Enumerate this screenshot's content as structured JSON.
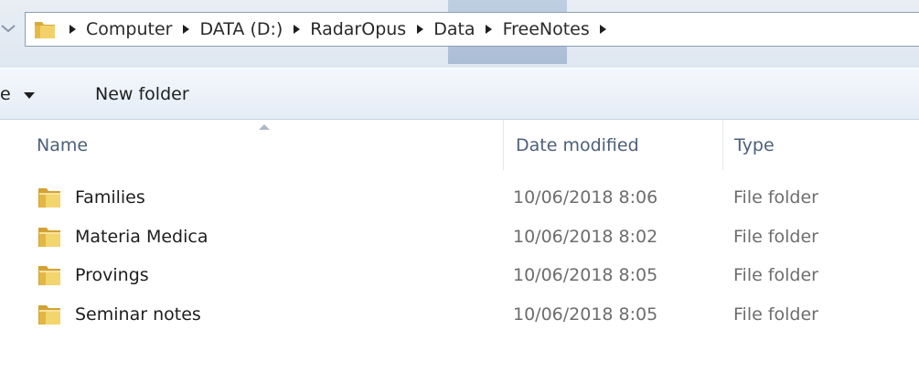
{
  "breadcrumb": [
    {
      "label": "Computer"
    },
    {
      "label": "DATA (D:)"
    },
    {
      "label": "RadarOpus"
    },
    {
      "label": "Data"
    },
    {
      "label": "FreeNotes"
    }
  ],
  "toolbar": {
    "organize_label": "e",
    "new_folder_label": "New folder"
  },
  "columns": {
    "name": "Name",
    "date_modified": "Date modified",
    "type": "Type"
  },
  "files": [
    {
      "name": "Families",
      "date": "10/06/2018 8:06",
      "type": "File folder",
      "icon": "folder-icon"
    },
    {
      "name": "Materia Medica",
      "date": "10/06/2018 8:02",
      "type": "File folder",
      "icon": "folder-icon"
    },
    {
      "name": "Provings",
      "date": "10/06/2018 8:05",
      "type": "File folder",
      "icon": "folder-icon"
    },
    {
      "name": "Seminar notes",
      "date": "10/06/2018 8:05",
      "type": "File folder",
      "icon": "folder-icon"
    }
  ],
  "colors": {
    "header_text": "#4c607a",
    "meta_text": "#6d6d6d",
    "toolbar_bg": "#e4ecf6",
    "folder_yellow": "#e9c25a"
  }
}
